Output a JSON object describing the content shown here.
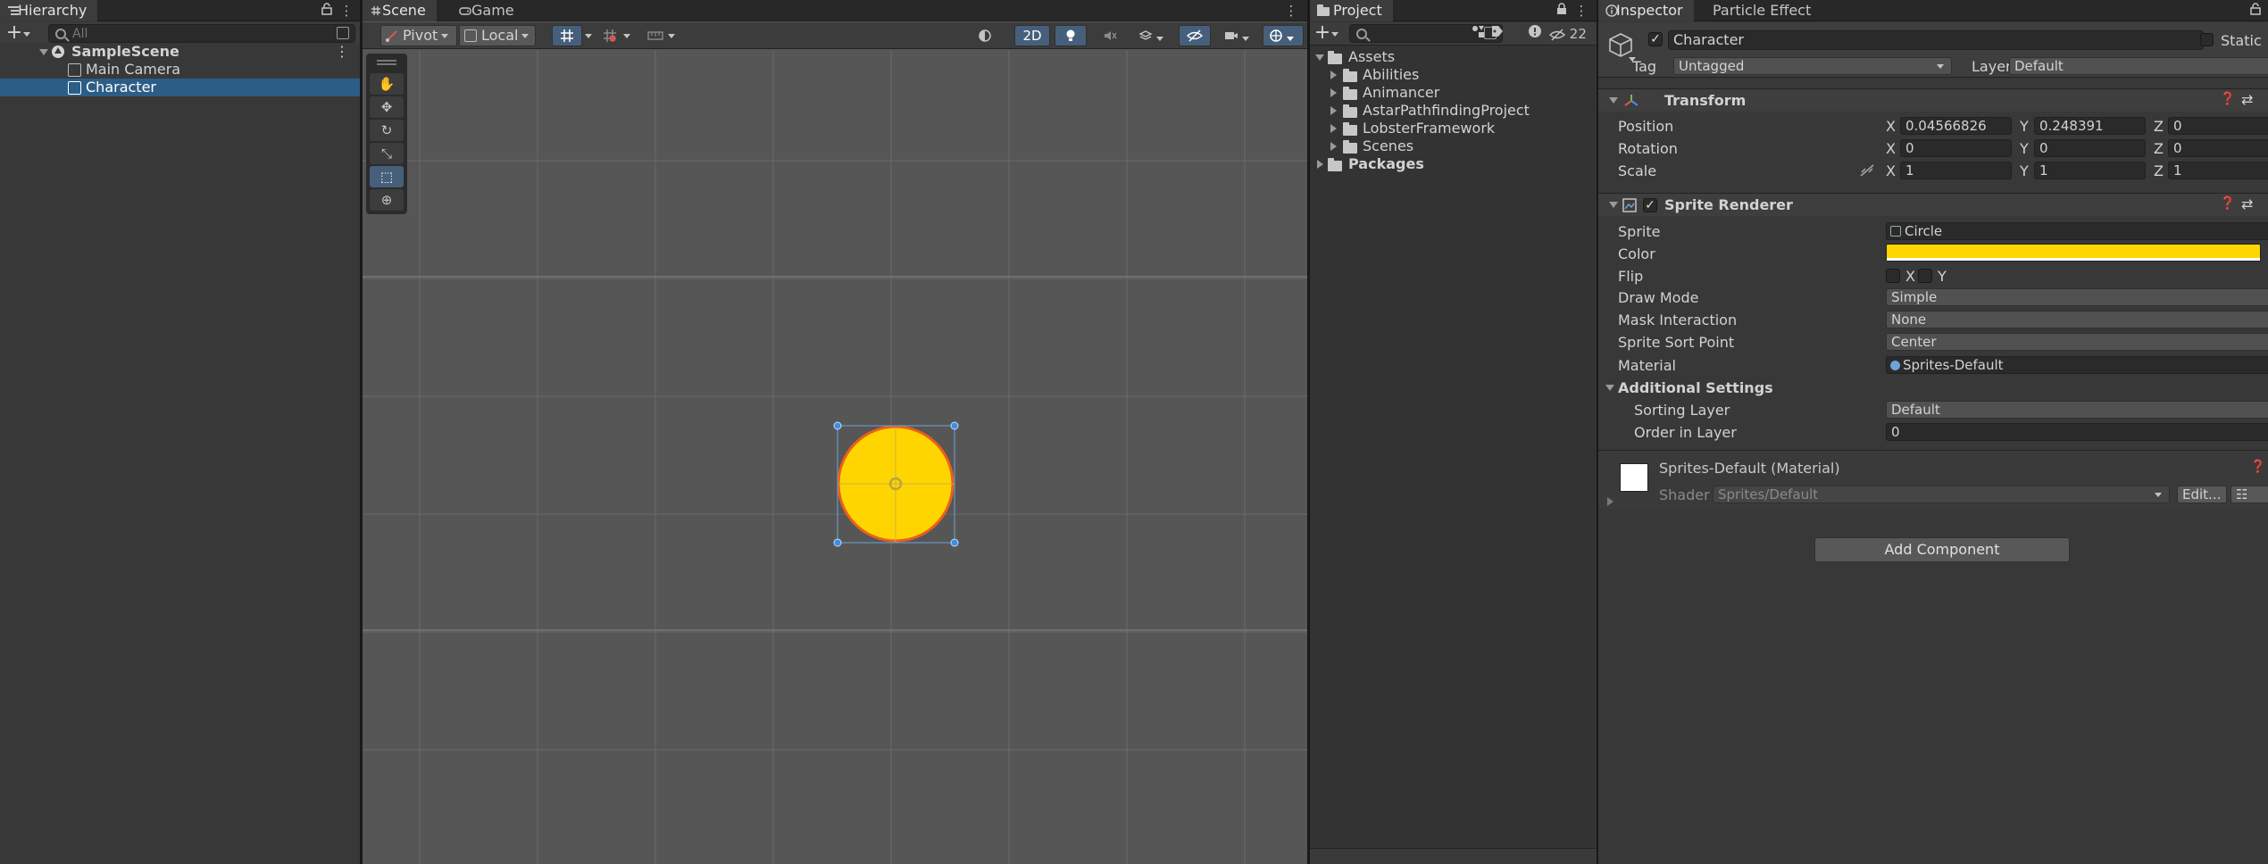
{
  "hierarchy": {
    "tab_label": "Hierarchy",
    "search_placeholder": "All",
    "scene_name": "SampleScene",
    "items": [
      {
        "label": "Main Camera"
      },
      {
        "label": "Character"
      }
    ]
  },
  "scene_view": {
    "tabs": [
      {
        "label": "Scene"
      },
      {
        "label": "Game"
      }
    ],
    "pivot_label": "Pivot",
    "local_label": "Local",
    "mode_2d_label": "2D",
    "sprite_color": "#ffd500",
    "sprite_outline_color": "#e8601c"
  },
  "project": {
    "tab_label": "Project",
    "hidden_count": "22",
    "assets_label": "Assets",
    "folders": [
      {
        "label": "Abilities"
      },
      {
        "label": "Animancer"
      },
      {
        "label": "AstarPathfindingProject"
      },
      {
        "label": "LobsterFramework"
      },
      {
        "label": "Scenes"
      }
    ],
    "packages_label": "Packages"
  },
  "inspector": {
    "tabs": [
      {
        "label": "Inspector"
      },
      {
        "label": "Particle Effect"
      }
    ],
    "object_name": "Character",
    "static_label": "Static",
    "tag_label": "Tag",
    "tag_value": "Untagged",
    "layer_label": "Layer",
    "layer_value": "Default",
    "transform": {
      "title": "Transform",
      "position_label": "Position",
      "rotation_label": "Rotation",
      "scale_label": "Scale",
      "position": {
        "x": "0.04566826",
        "y": "0.248391",
        "z": "0"
      },
      "rotation": {
        "x": "0",
        "y": "0",
        "z": "0"
      },
      "scale": {
        "x": "1",
        "y": "1",
        "z": "1"
      },
      "axis_x": "X",
      "axis_y": "Y",
      "axis_z": "Z"
    },
    "sprite_renderer": {
      "title": "Sprite Renderer",
      "sprite_label": "Sprite",
      "sprite_value": "Circle",
      "color_label": "Color",
      "color_value": "#ffd600",
      "flip_label": "Flip",
      "flip_x": "X",
      "flip_y": "Y",
      "draw_mode_label": "Draw Mode",
      "draw_mode_value": "Simple",
      "mask_label": "Mask Interaction",
      "mask_value": "None",
      "sort_point_label": "Sprite Sort Point",
      "sort_point_value": "Center",
      "material_label": "Material",
      "material_value": "Sprites-Default",
      "additional_label": "Additional Settings",
      "sorting_layer_label": "Sorting Layer",
      "sorting_layer_value": "Default",
      "order_label": "Order in Layer",
      "order_value": "0"
    },
    "material": {
      "title": "Sprites-Default (Material)",
      "shader_label": "Shader",
      "shader_value": "Sprites/Default",
      "edit_label": "Edit..."
    },
    "add_component_label": "Add Component"
  }
}
